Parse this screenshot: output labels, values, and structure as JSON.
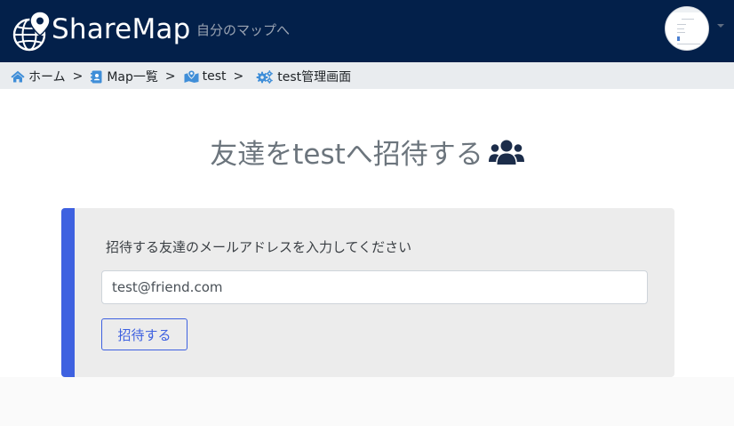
{
  "navbar": {
    "brand_name": "ShareMap",
    "tagline": "自分のマップへ",
    "logo_icon": "globe-pin-icon",
    "avatar_icon": "user-avatar-thumbnail"
  },
  "breadcrumb": {
    "items": [
      {
        "label": "ホーム",
        "icon": "home-icon"
      },
      {
        "label": "Map一覧",
        "icon": "address-book-icon"
      },
      {
        "label": "test",
        "icon": "map-marked-icon"
      },
      {
        "label": "test管理画面",
        "icon": "cogs-icon"
      }
    ],
    "separator": ">"
  },
  "main": {
    "title": "友達をtestへ招待する",
    "title_icon": "users-icon"
  },
  "invite_form": {
    "prompt": "招待する友達のメールアドレスを入力してください",
    "email_value": "test@friend.com",
    "submit_label": "招待する"
  },
  "colors": {
    "navbar_bg": "#03204a",
    "accent": "#3e61e0",
    "breadcrumb_bg": "#e9ecef",
    "icon_blue": "#3f8ed8"
  }
}
